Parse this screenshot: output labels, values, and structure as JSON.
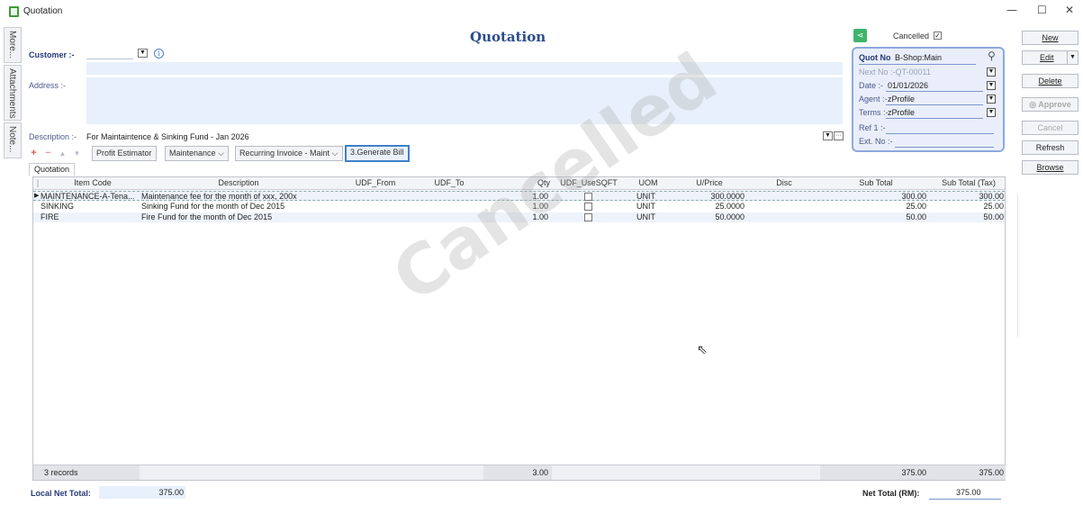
{
  "window": {
    "title": "Quotation",
    "minimize": "—",
    "maximize": "☐",
    "close": "✕"
  },
  "side_tabs": [
    "More...",
    "Attachments",
    "Note..."
  ],
  "form": {
    "title": "Quotation",
    "customer_label": "Customer :-",
    "address_label": "Address :-",
    "description_label": "Description :-",
    "description_value": "For Maintaintence & Sinking Fund - Jan 2026"
  },
  "toolbar": {
    "profit_estimator": "Profit Estimator",
    "maintenance": "Maintenance",
    "recurring": "Recurring Invoice - Maint",
    "generate_bill": "3.Generate Bill"
  },
  "tabs": [
    "Quotation"
  ],
  "grid": {
    "columns": [
      "Item Code",
      "Description",
      "UDF_From",
      "UDF_To",
      "Qty",
      "UDF_UseSQFT",
      "UOM",
      "U/Price",
      "Disc",
      "Sub Total",
      "Sub Total (Tax)"
    ],
    "rows": [
      {
        "item_code": "MAINTENANCE-A-Tena...",
        "description": "Maintenance fee for the month of xxx, 200x",
        "udf_from": "",
        "udf_to": "",
        "qty": "1.00",
        "use_sqft": false,
        "uom": "UNIT",
        "uprice": "300.0000",
        "disc": "",
        "sub_total": "300.00",
        "sub_total_tax": "300.00"
      },
      {
        "item_code": "SINKING",
        "description": "Sinking Fund for the month of Dec 2015",
        "udf_from": "",
        "udf_to": "",
        "qty": "1.00",
        "use_sqft": false,
        "uom": "UNIT",
        "uprice": "25.0000",
        "disc": "",
        "sub_total": "25.00",
        "sub_total_tax": "25.00"
      },
      {
        "item_code": "FIRE",
        "description": "Fire Fund for the month of Dec 2015",
        "udf_from": "",
        "udf_to": "",
        "qty": "1.00",
        "use_sqft": false,
        "uom": "UNIT",
        "uprice": "50.0000",
        "disc": "",
        "sub_total": "50.00",
        "sub_total_tax": "50.00"
      }
    ],
    "footer": {
      "records": "3 records",
      "qty_total": "3.00",
      "sub_total": "375.00",
      "sub_total_tax": "375.00"
    }
  },
  "watermark": "Cancelled",
  "totals": {
    "local_label": "Local Net Total:",
    "local_value": "375.00",
    "net_label": "Net Total (RM):",
    "net_value": "375.00"
  },
  "header_right": {
    "cancelled_label": "Cancelled",
    "cancelled_checked": "✓"
  },
  "info_panel": {
    "quot_no_label": "Quot No",
    "quot_no_value": "B-Shop:Main",
    "next_no": "Next No :-QT-00011",
    "date_label": "Date :-",
    "date_value": "01/01/2026",
    "agent_label": "Agent :-",
    "agent_value": "zProfile",
    "terms_label": "Terms :-",
    "terms_value": "zProfile",
    "ref1_label": "Ref 1 :-",
    "extno_label": "Ext. No :-"
  },
  "actions": {
    "new": "New",
    "edit": "Edit",
    "delete": "Delete",
    "approve": "Approve",
    "cancel": "Cancel",
    "refresh": "Refresh",
    "browse": "Browse"
  }
}
